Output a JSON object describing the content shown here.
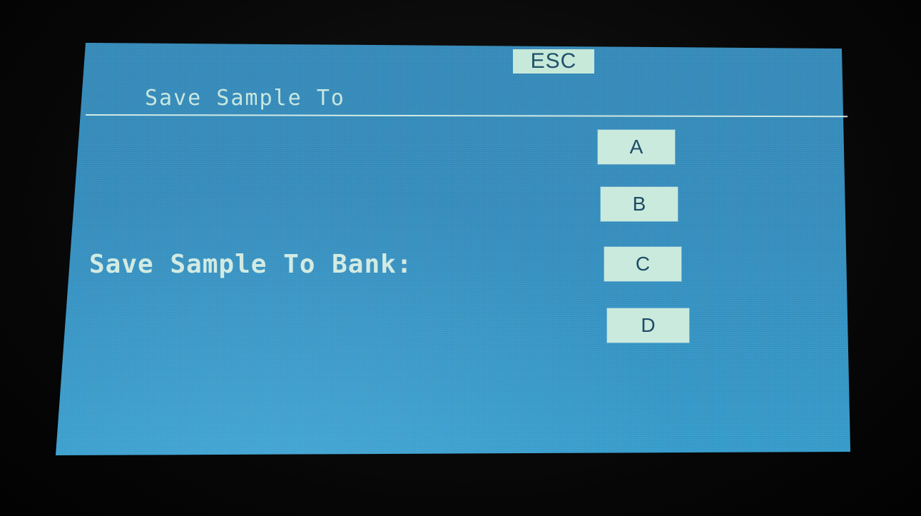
{
  "header": {
    "esc_label": "ESC",
    "title": "Save Sample To"
  },
  "main": {
    "prompt_label": "Save Sample To Bank:",
    "banks": [
      {
        "label": "A"
      },
      {
        "label": "B"
      },
      {
        "label": "C"
      },
      {
        "label": "D"
      }
    ]
  },
  "colors": {
    "screen_background": "#3a92c2",
    "button_background": "#c9eadc",
    "button_text": "#1f4b66",
    "text": "#c8e7df",
    "bezel": "#050505"
  }
}
